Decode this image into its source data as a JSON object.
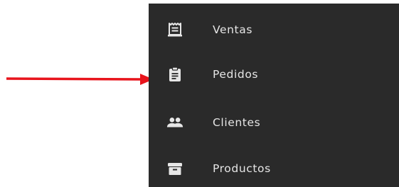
{
  "annotation": {
    "arrow_color": "#e8141c"
  },
  "menu": {
    "background": "#2a2a2a",
    "text_color": "#e6e6e6",
    "items": [
      {
        "label": "Ventas",
        "icon": "receipt-icon"
      },
      {
        "label": "Pedidos",
        "icon": "clipboard-icon"
      },
      {
        "label": "Clientes",
        "icon": "people-icon"
      },
      {
        "label": "Productos",
        "icon": "archive-box-icon"
      }
    ]
  }
}
